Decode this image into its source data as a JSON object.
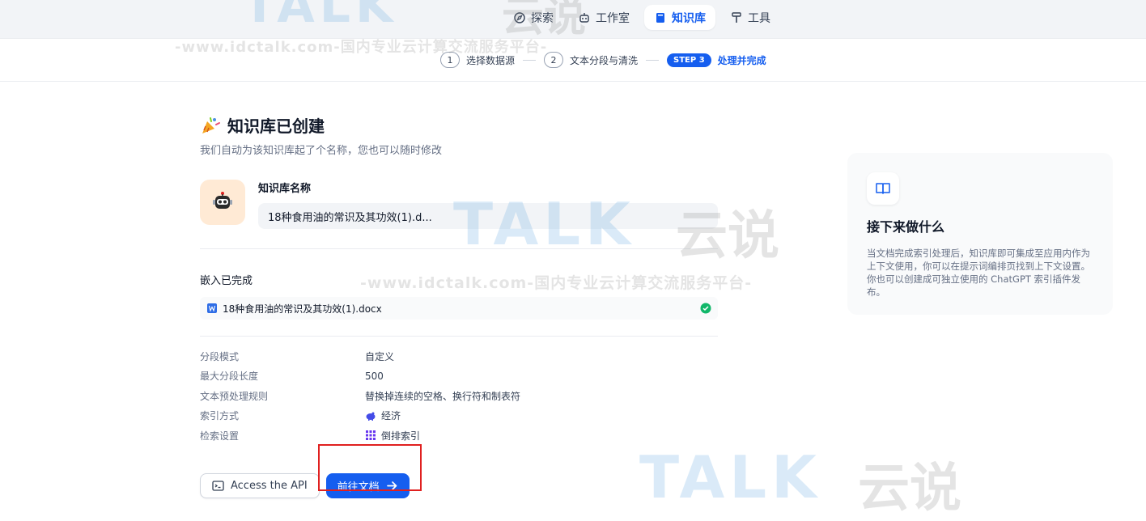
{
  "nav": {
    "items": [
      {
        "label": "探索",
        "icon": "compass-icon"
      },
      {
        "label": "工作室",
        "icon": "robot-icon"
      },
      {
        "label": "知识库",
        "icon": "book-icon",
        "active": true
      },
      {
        "label": "工具",
        "icon": "hammer-icon"
      }
    ]
  },
  "steps": {
    "step1": {
      "num": "1",
      "label": "选择数据源"
    },
    "step2": {
      "num": "2",
      "label": "文本分段与清洗"
    },
    "step3": {
      "badge": "STEP 3",
      "label": "处理并完成"
    }
  },
  "main": {
    "title": "知识库已创建",
    "subtitle": "我们自动为该知识库起了个名称，您也可以随时修改",
    "kb_name_label": "知识库名称",
    "kb_name_value": "18种食用油的常识及其功效(1).d...",
    "embed_title": "嵌入已完成",
    "file_name": "18种食用油的常识及其功效(1).docx",
    "settings": [
      {
        "key": "分段模式",
        "value": "自定义"
      },
      {
        "key": "最大分段长度",
        "value": "500"
      },
      {
        "key": "文本预处理规则",
        "value": "替换掉连续的空格、换行符和制表符"
      },
      {
        "key": "索引方式",
        "value": "经济",
        "icon": "piggy-bank-icon"
      },
      {
        "key": "检索设置",
        "value": "倒排索引",
        "icon": "grid-icon"
      }
    ],
    "api_button": "Access the API",
    "doc_button": "前往文档"
  },
  "side": {
    "title": "接下来做什么",
    "text": "当文档完成索引处理后，知识库即可集成至应用内作为上下文使用，你可以在提示词编排页找到上下文设置。你也可以创建成可独立使用的 ChatGPT 索引插件发布。"
  },
  "watermark": {
    "brand": "TALK",
    "brand_cn": "云说",
    "url": "-www.idctalk.com-国内专业云计算交流服务平台-"
  },
  "colors": {
    "accent": "#155eef",
    "highlight": "#e0201f",
    "success": "#12b76a"
  }
}
